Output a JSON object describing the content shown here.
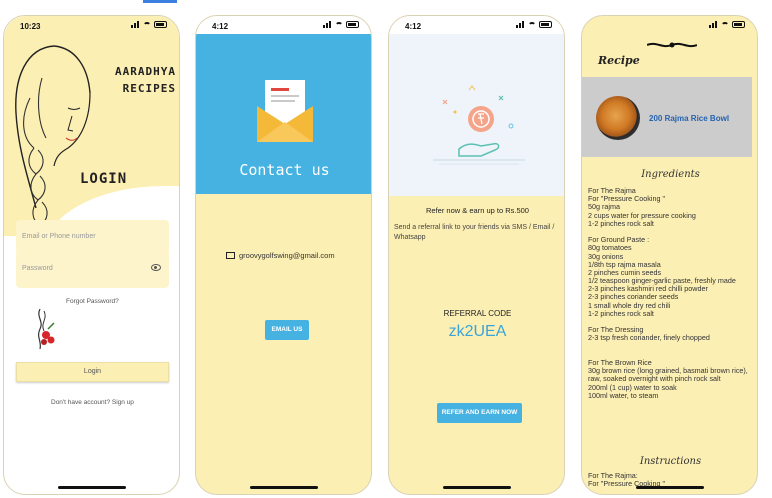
{
  "login_screen": {
    "status_time": "10:23",
    "brand_line1": "AARADHYA",
    "brand_line2": "RECIPES",
    "title": "LOGIN",
    "email_placeholder": "Email or Phone number",
    "password_placeholder": "Password",
    "forgot_password": "Forgot Password?",
    "login_button": "Login",
    "signup_prompt": "Don't have account? Sign up"
  },
  "contact_screen": {
    "status_time": "4:12",
    "title": "Contact us",
    "email": "groovygolfswing@gmail.com",
    "email_button": "EMAIL US"
  },
  "refer_screen": {
    "status_time": "4:12",
    "headline": "Refer now & earn up to Rs.500",
    "description": "Send a referral link to your friends via SMS / Email / Whatsapp",
    "code_label": "REFERRAL CODE",
    "code": "zk2UEA",
    "refer_button": "REFER AND EARN NOW"
  },
  "recipe_screen": {
    "title": "Recipe",
    "card_title": "200 Rajma Rice Bowl",
    "ingredients_heading": "Ingredients",
    "ingredient_lines": [
      "For The Rajma",
      "For \"Pressure Cooking \"",
      "50g rajma",
      "2 cups water for pressure cooking",
      "1-2 pinches rock salt",
      "",
      "For Ground Paste :",
      "80g tomatoes",
      "30g onions",
      "1/8th tsp rajma masala",
      "2 pinches cumin seeds",
      "1/2 teaspoon ginger-garlic paste, freshly made",
      "2-3 pinches kashmiri red chilli powder",
      "2-3 pinches coriander seeds",
      "1 small whole dry red chili",
      "1-2 pinches rock salt",
      "",
      "For The Dressing",
      "2-3 tsp fresh coriander, finely chopped",
      "",
      "",
      "For The Brown Rice",
      "30g brown rice (long grained, basmati brown rice),",
      "raw, soaked overnight with pinch rock salt",
      "200ml (1 cup) water to soak",
      "100ml water, to steam"
    ],
    "instructions_heading": "Instructions",
    "instruction_lines": [
      "For The Rajma:",
      "For \"Pressure Cooking \""
    ]
  },
  "colors": {
    "cream": "#fcefb4",
    "blue": "#45b2e1",
    "code_blue": "#3aa4d8"
  }
}
